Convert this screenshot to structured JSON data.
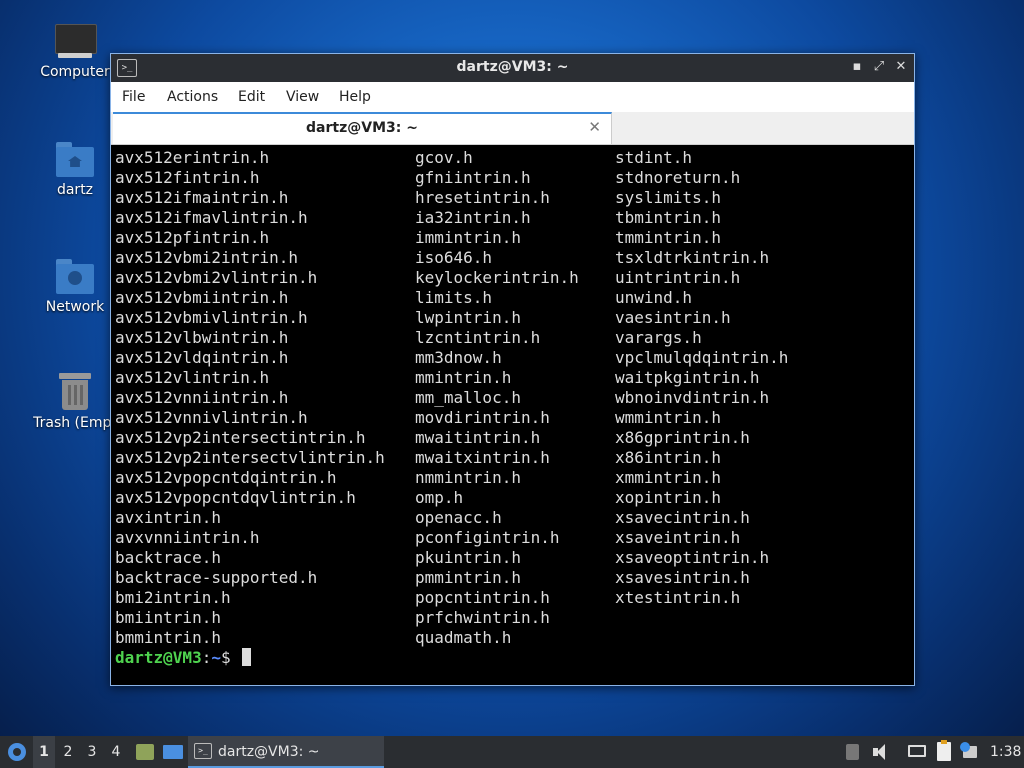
{
  "desktop": {
    "icons": [
      {
        "label": "Computer"
      },
      {
        "label": "dartz"
      },
      {
        "label": "Network"
      },
      {
        "label": "Trash (Empt"
      }
    ]
  },
  "window": {
    "title": "dartz@VM3: ~",
    "controls": {
      "minimize": "▪",
      "maximize": "⤢",
      "close": "✕"
    },
    "menu": [
      "File",
      "Actions",
      "Edit",
      "View",
      "Help"
    ],
    "tab": {
      "label": "dartz@VM3: ~",
      "close": "✕"
    }
  },
  "terminal": {
    "col1": [
      "avx512erintrin.h",
      "avx512fintrin.h",
      "avx512ifmaintrin.h",
      "avx512ifmavlintrin.h",
      "avx512pfintrin.h",
      "avx512vbmi2intrin.h",
      "avx512vbmi2vlintrin.h",
      "avx512vbmiintrin.h",
      "avx512vbmivlintrin.h",
      "avx512vlbwintrin.h",
      "avx512vldqintrin.h",
      "avx512vlintrin.h",
      "avx512vnniintrin.h",
      "avx512vnnivlintrin.h",
      "avx512vp2intersectintrin.h",
      "avx512vp2intersectvlintrin.h",
      "avx512vpopcntdqintrin.h",
      "avx512vpopcntdqvlintrin.h",
      "avxintrin.h",
      "avxvnniintrin.h",
      "backtrace.h",
      "backtrace-supported.h",
      "bmi2intrin.h",
      "bmiintrin.h",
      "bmmintrin.h"
    ],
    "col2": [
      "gcov.h",
      "gfniintrin.h",
      "hresetintrin.h",
      "ia32intrin.h",
      "immintrin.h",
      "iso646.h",
      "keylockerintrin.h",
      "limits.h",
      "lwpintrin.h",
      "lzcntintrin.h",
      "mm3dnow.h",
      "mmintrin.h",
      "mm_malloc.h",
      "movdirintrin.h",
      "mwaitintrin.h",
      "mwaitxintrin.h",
      "nmmintrin.h",
      "omp.h",
      "openacc.h",
      "pconfigintrin.h",
      "pkuintrin.h",
      "pmmintrin.h",
      "popcntintrin.h",
      "prfchwintrin.h",
      "quadmath.h"
    ],
    "col3": [
      "stdint.h",
      "stdnoreturn.h",
      "syslimits.h",
      "tbmintrin.h",
      "tmmintrin.h",
      "tsxldtrkintrin.h",
      "uintrintrin.h",
      "unwind.h",
      "vaesintrin.h",
      "varargs.h",
      "vpclmulqdqintrin.h",
      "waitpkgintrin.h",
      "wbnoinvdintrin.h",
      "wmmintrin.h",
      "x86gprintrin.h",
      "x86intrin.h",
      "xmmintrin.h",
      "xopintrin.h",
      "xsavecintrin.h",
      "xsaveintrin.h",
      "xsaveoptintrin.h",
      "xsavesintrin.h",
      "xtestintrin.h"
    ],
    "prompt": {
      "user": "dartz@VM3",
      "sep": ":",
      "path": "~",
      "symbol": "$ "
    }
  },
  "taskbar": {
    "workspaces": [
      "1",
      "2",
      "3",
      "4"
    ],
    "active_workspace": "1",
    "task_label": "dartz@VM3: ~",
    "clock": "1:38"
  },
  "colors": {
    "accent": "#3c8ad9",
    "prompt_user": "#4fd34f",
    "prompt_path": "#5a8cff"
  }
}
